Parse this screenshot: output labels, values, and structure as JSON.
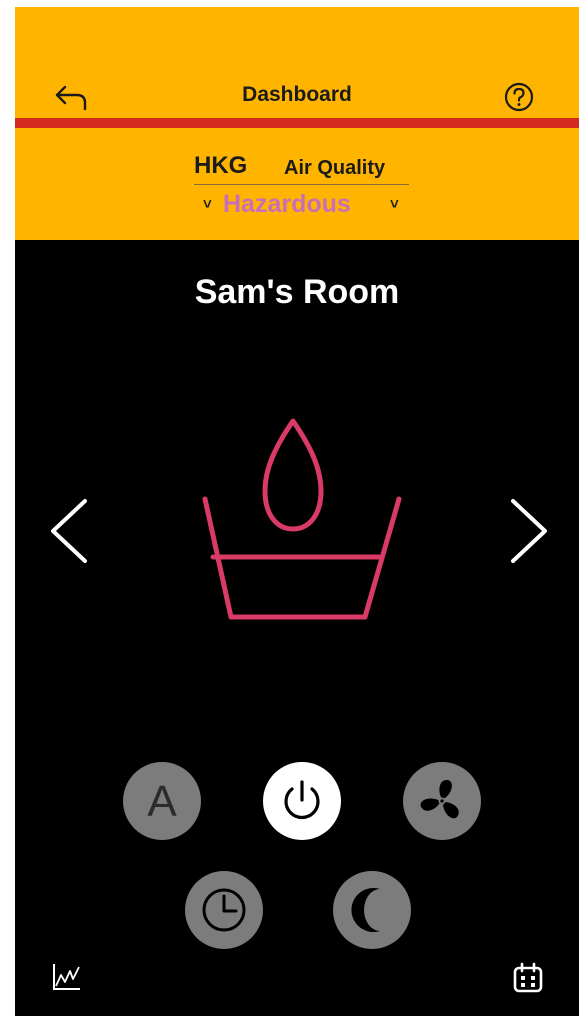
{
  "header": {
    "title": "Dashboard",
    "back_icon": "back-arrow-icon",
    "help_icon": "help-circle-icon"
  },
  "air_quality": {
    "city": "HKG",
    "label": "Air Quality",
    "status": "Hazardous",
    "status_color": "#C86FB8",
    "chevron": "˅"
  },
  "room": {
    "name": "Sam's Room",
    "mode_icon": "humidifier-icon",
    "mode_icon_color": "#D93A66"
  },
  "navigation": {
    "prev_icon": "chevron-left-icon",
    "next_icon": "chevron-right-icon"
  },
  "controls": {
    "auto_label": "A",
    "power_active": true,
    "items": [
      "auto-mode",
      "power",
      "fan-speed",
      "timer",
      "night-mode"
    ]
  },
  "footer": {
    "left_icon": "chart-icon",
    "right_icon": "calendar-icon"
  },
  "colors": {
    "header_bg": "#FFB400",
    "accent_rule": "#D42A1F",
    "body_bg": "#000000",
    "control_bg": "#7c7c7c",
    "control_active_bg": "#ffffff"
  }
}
